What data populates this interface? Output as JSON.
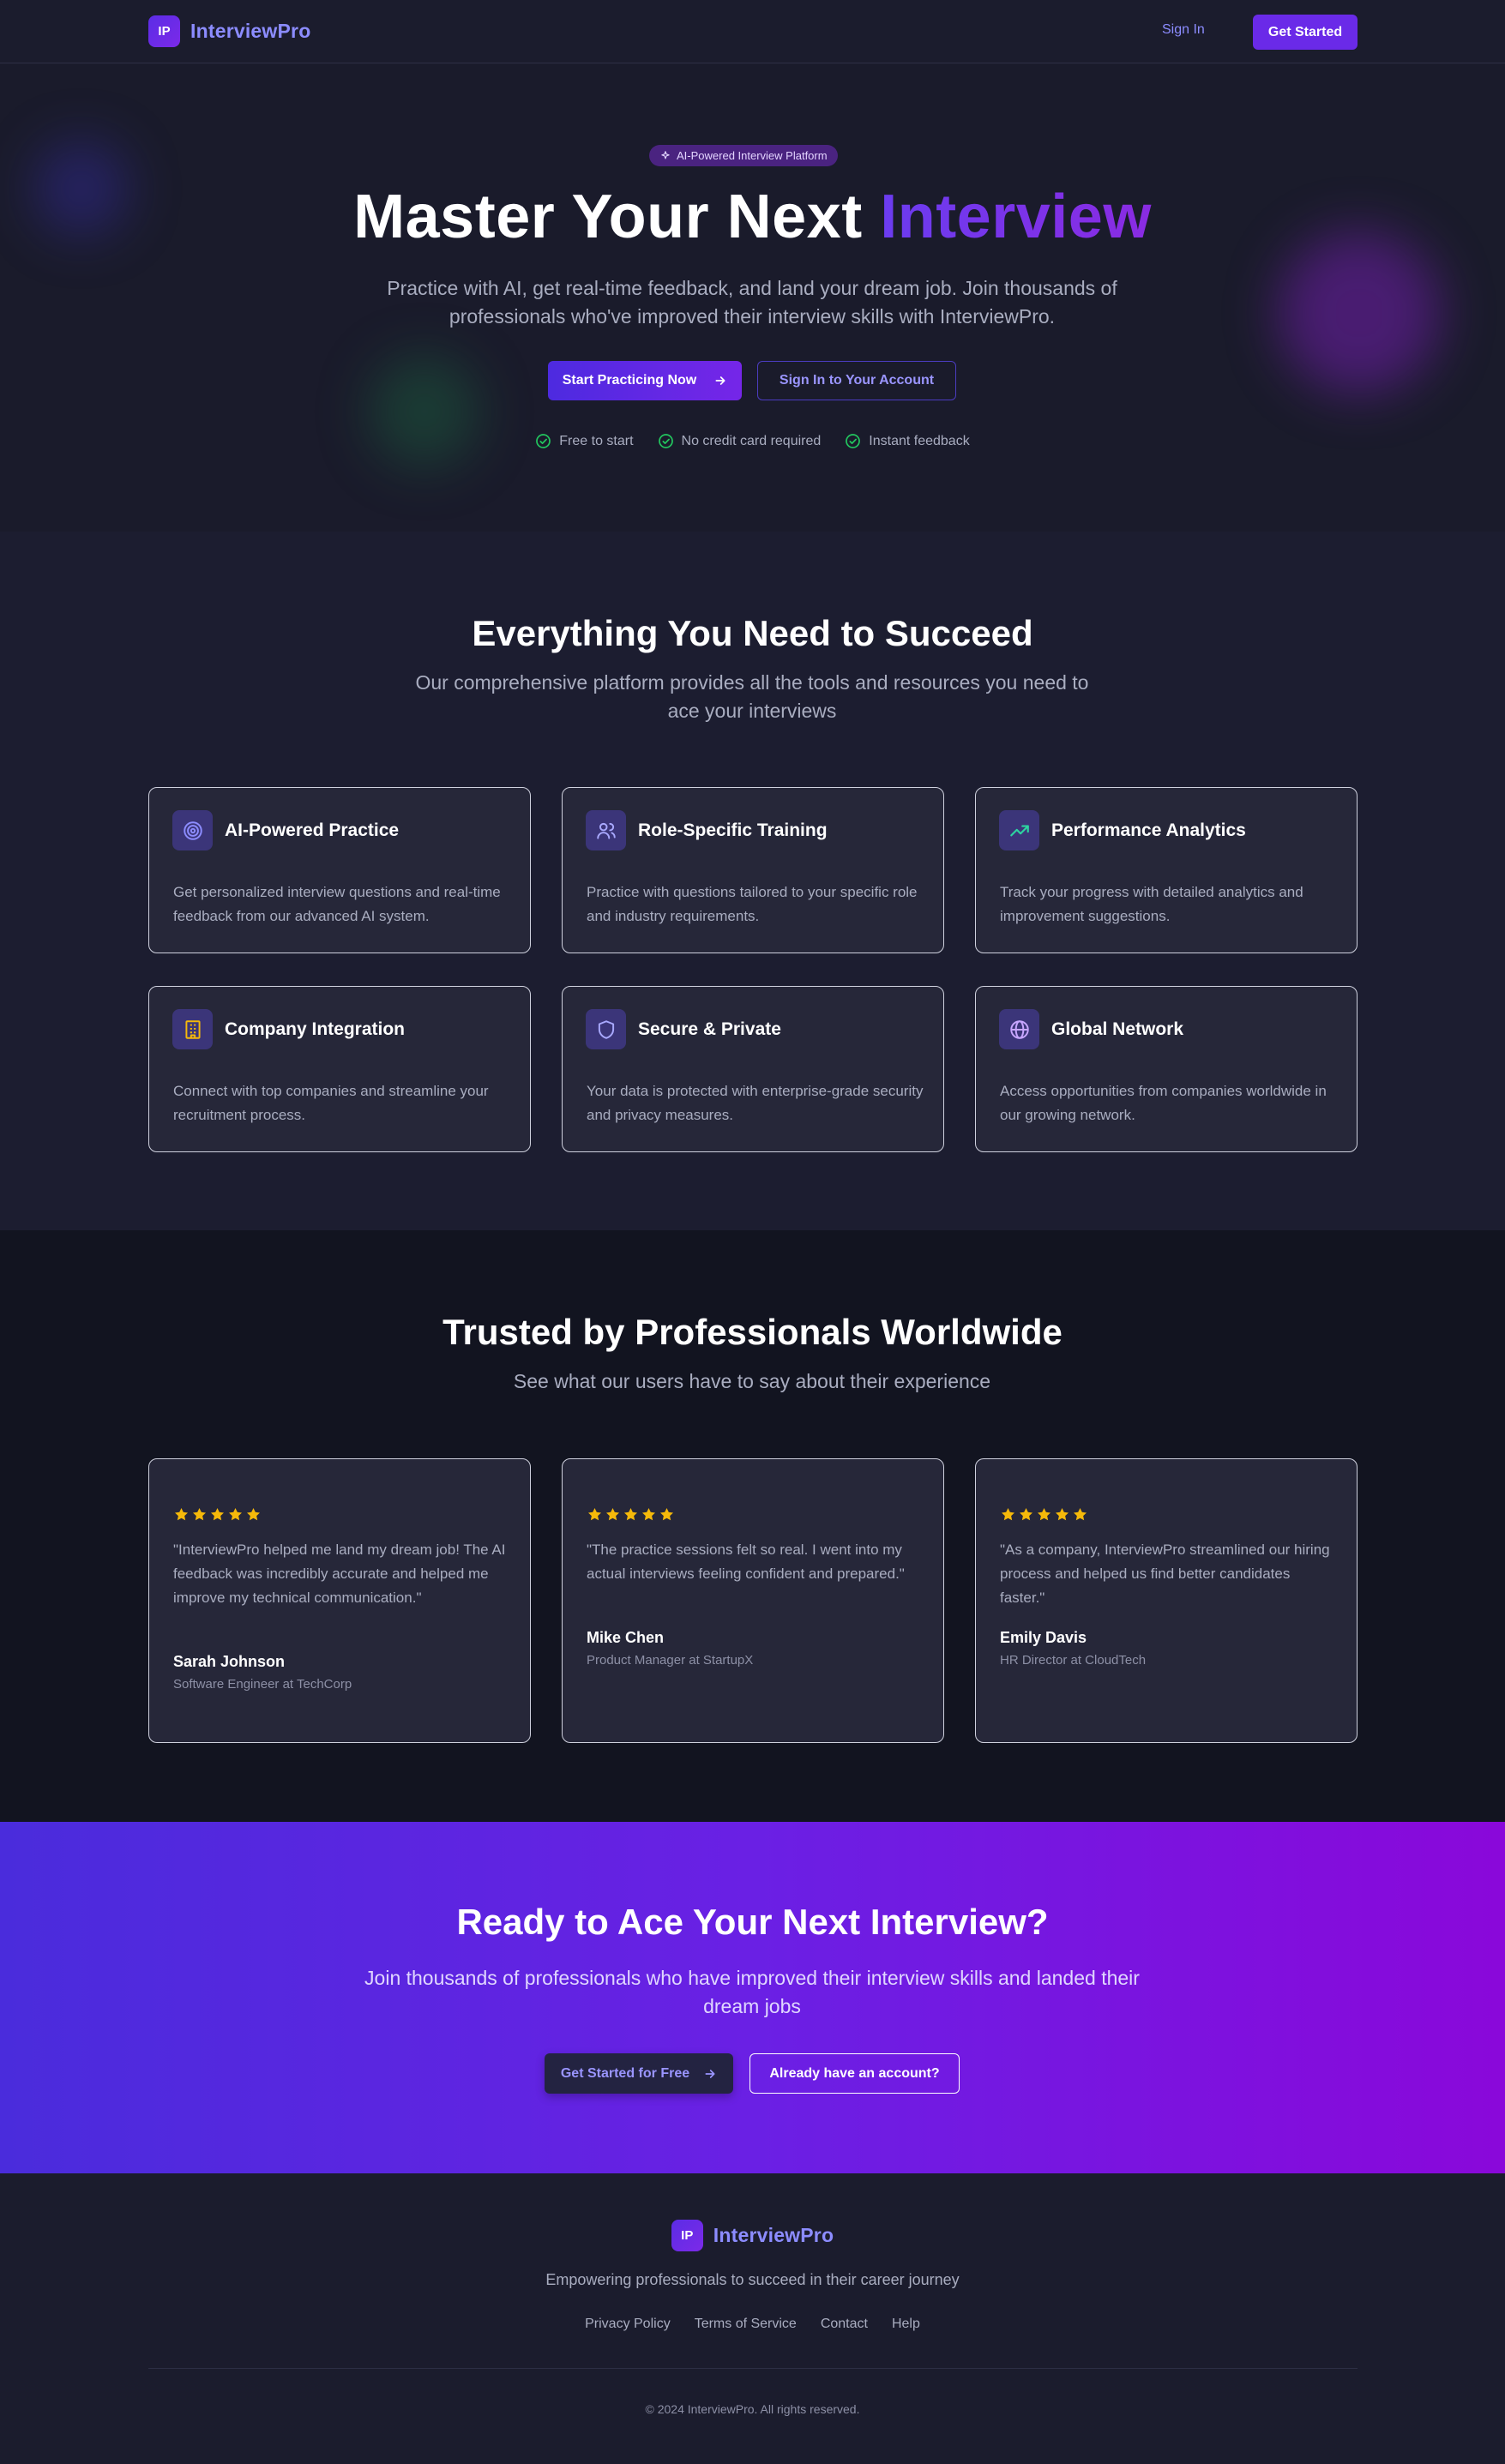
{
  "nav": {
    "logo_text": "IP",
    "brand": "InterviewPro",
    "signin": "Sign In",
    "get_started": "Get Started"
  },
  "hero": {
    "badge": "AI-Powered Interview Platform",
    "title_main": "Master Your Next",
    "title_accent": "Interview",
    "subtitle": "Practice with AI, get real-time feedback, and land your dream job. Join thousands of professionals who've improved their interview skills with InterviewPro.",
    "primary_button": "Start Practicing Now",
    "secondary_button": "Sign In to Your Account",
    "perks": [
      "Free to start",
      "No credit card required",
      "Instant feedback"
    ]
  },
  "features": {
    "title": "Everything You Need to Succeed",
    "subtitle": "Our comprehensive platform provides all the tools and resources you need to ace your interviews",
    "cards": [
      {
        "icon": "target-icon",
        "title": "AI-Powered Practice",
        "desc": "Get personalized interview questions and real-time feedback from our advanced AI system."
      },
      {
        "icon": "users-icon",
        "title": "Role-Specific Training",
        "desc": "Practice with questions tailored to your specific role and industry requirements."
      },
      {
        "icon": "trending-up-icon",
        "title": "Performance Analytics",
        "desc": "Track your progress with detailed analytics and improvement suggestions."
      },
      {
        "icon": "building-icon",
        "title": "Company Integration",
        "desc": "Connect with top companies and streamline your recruitment process."
      },
      {
        "icon": "shield-icon",
        "title": "Secure & Private",
        "desc": "Your data is protected with enterprise-grade security and privacy measures."
      },
      {
        "icon": "globe-icon",
        "title": "Global Network",
        "desc": "Access opportunities from companies worldwide in our growing network."
      }
    ]
  },
  "testimonials": {
    "title": "Trusted by Professionals Worldwide",
    "subtitle": "See what our users have to say about their experience",
    "items": [
      {
        "rating": 5,
        "quote": "\"InterviewPro helped me land my dream job! The AI feedback was incredibly accurate and helped me improve my technical communication.\"",
        "name": "Sarah Johnson",
        "role": "Software Engineer at TechCorp"
      },
      {
        "rating": 5,
        "quote": "\"The practice sessions felt so real. I went into my actual interviews feeling confident and prepared.\"",
        "name": "Mike Chen",
        "role": "Product Manager at StartupX"
      },
      {
        "rating": 5,
        "quote": "\"As a company, InterviewPro streamlined our hiring process and helped us find better candidates faster.\"",
        "name": "Emily Davis",
        "role": "HR Director at CloudTech"
      }
    ]
  },
  "cta": {
    "title": "Ready to Ace Your Next Interview?",
    "subtitle": "Join thousands of professionals who have improved their interview skills and landed their dream jobs",
    "primary_button": "Get Started for Free",
    "secondary_button": "Already have an account?"
  },
  "footer": {
    "logo_text": "IP",
    "brand": "InterviewPro",
    "tagline": "Empowering professionals to succeed in their career journey",
    "links": [
      "Privacy Policy",
      "Terms of Service",
      "Contact",
      "Help"
    ],
    "copyright": "© 2024 InterviewPro. All rights reserved."
  },
  "colors": {
    "accent": "#6a2ae8",
    "brand_text": "#8c8cff",
    "star": "#f5b90a",
    "check": "#22c55e"
  }
}
